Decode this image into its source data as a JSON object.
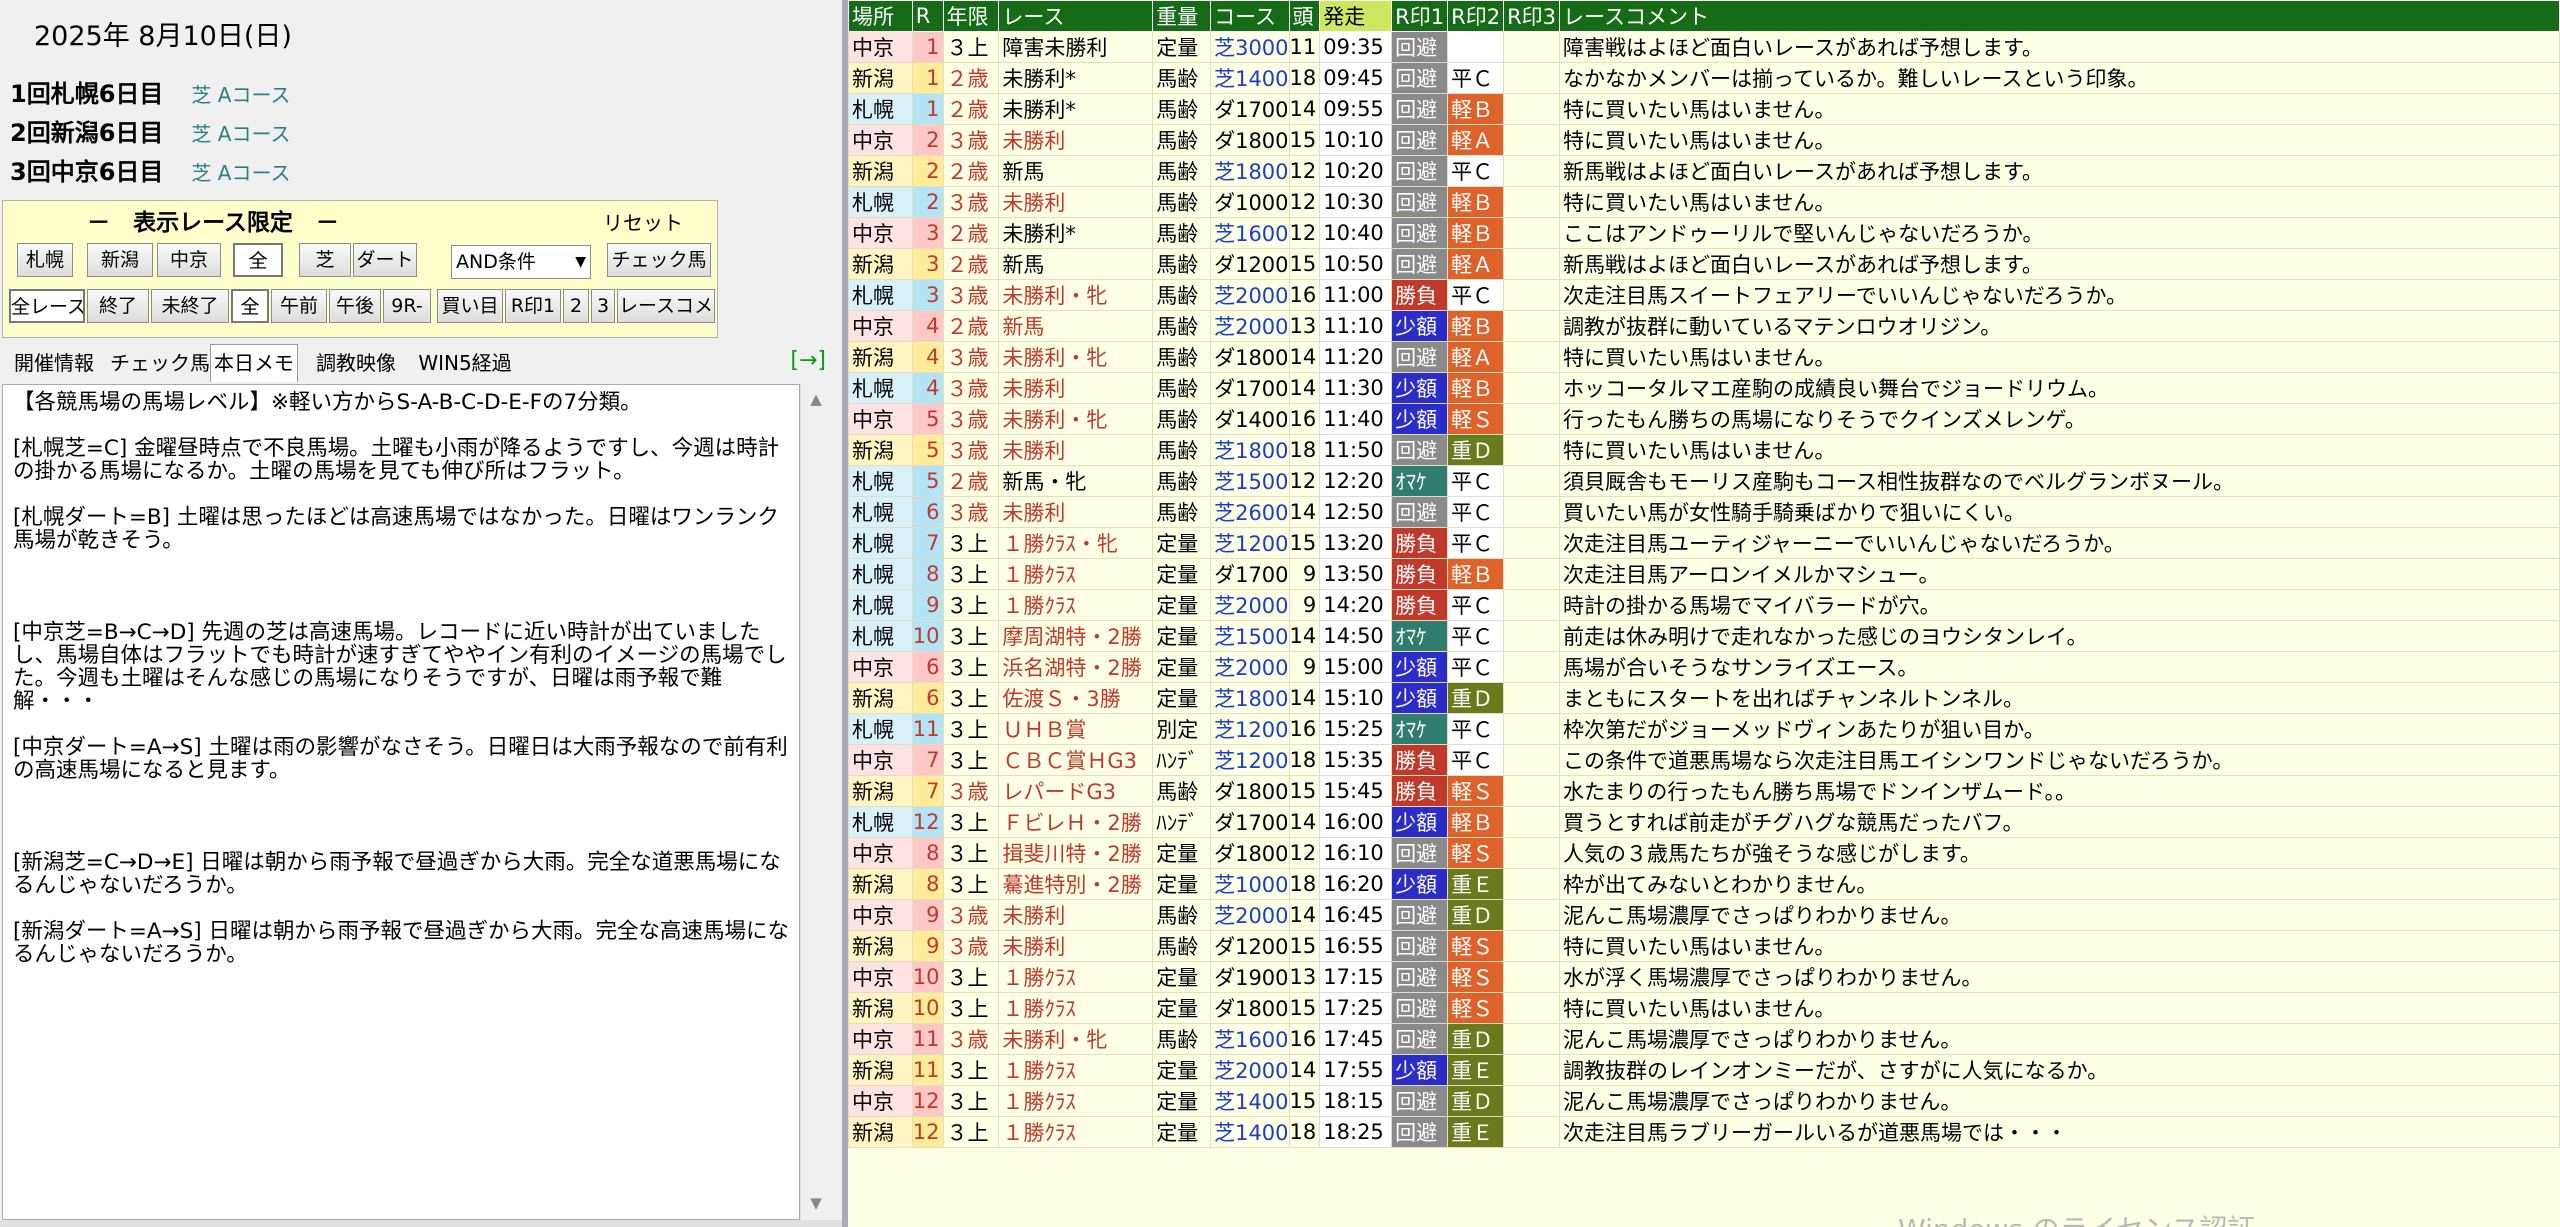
{
  "date": "2025年 8月10日(日)",
  "meetings": [
    {
      "name": "1回札幌6日目",
      "course": "芝 Aコース"
    },
    {
      "name": "2回新潟6日目",
      "course": "芝 Aコース"
    },
    {
      "name": "3回中京6日目",
      "course": "芝 Aコース"
    }
  ],
  "filter": {
    "title": "－　表示レース限定　－",
    "reset": "リセット",
    "track_buttons": [
      "札幌",
      "新潟",
      "中京"
    ],
    "surface_buttons": [
      "全",
      "芝",
      "ダート"
    ],
    "condition": "AND条件",
    "condition_arrow": "▼",
    "check_btn": "チェック馬",
    "row2": [
      "全レース",
      "終了",
      "未終了",
      "全",
      "午前",
      "午後",
      "9R-",
      "買い目",
      "R印1",
      "2",
      "3",
      "レースコメ"
    ]
  },
  "tabs": [
    "開催情報",
    "チェック馬",
    "本日メモ",
    "調教映像",
    "WIN5経過"
  ],
  "tab_arrow": "[→]",
  "memo": [
    "【各競馬場の馬場レベル】※軽い方からS-A-B-C-D-E-Fの7分類。",
    "",
    "[札幌芝=C] 金曜昼時点で不良馬場。土曜も小雨が降るようですし、今週は時計の掛かる馬場になるか。土曜の馬場を見ても伸び所はフラット。",
    "",
    "[札幌ダート=B] 土曜は思ったほどは高速馬場ではなかった。日曜はワンランク馬場が乾きそう。",
    "",
    "",
    "",
    "[中京芝=B→C→D] 先週の芝は高速馬場。レコードに近い時計が出ていましたし、馬場自体はフラットでも時計が速すぎてややイン有利のイメージの馬場でした。今週も土曜はそんな感じの馬場になりそうですが、日曜は雨予報で難解・・・",
    "",
    "[中京ダート=A→S] 土曜は雨の影響がなさそう。日曜日は大雨予報なので前有利の高速馬場になると見ます。",
    "",
    "",
    "",
    "[新潟芝=C→D→E] 日曜は朝から雨予報で昼過ぎから大雨。完全な道悪馬場になるんじゃないだろうか。",
    "",
    "[新潟ダート=A→S] 日曜は朝から雨予報で昼過ぎから大雨。完全な高速馬場になるんじゃないだろうか。"
  ],
  "scroll_up": "▲",
  "scroll_down": "▼",
  "columns": [
    "場所",
    "R",
    "年限",
    "レース",
    "重量",
    "コース",
    "頭",
    "発走",
    "R印1",
    "R印2",
    "R印3",
    "レースコメント"
  ],
  "colors": {
    "header": "#166b16",
    "avoid": "#8a8a8a",
    "win": "#c0392b",
    "fixed": "#2c2cc8",
    "safe": "#2e7d6e",
    "light": "#e0622b",
    "heavy": "#6c7a1e"
  },
  "rows": [
    {
      "place": "中京",
      "r": "1",
      "age": "３上",
      "race": "障害未勝利",
      "wt": "定量",
      "course": "芝3000",
      "heads": "11",
      "post": "09:35",
      "m1": "回避",
      "m2": "",
      "m3": "",
      "comment": "障害戦はよほど面白いレースがあれば予想します。"
    },
    {
      "place": "新潟",
      "r": "1",
      "age": "２歳",
      "race": "未勝利*",
      "wt": "馬齢",
      "course": "芝1400",
      "heads": "18",
      "post": "09:45",
      "m1": "回避",
      "m2": "平Ｃ",
      "m3": "",
      "comment": "なかなかメンバーは揃っているか。難しいレースという印象。"
    },
    {
      "place": "札幌",
      "r": "1",
      "age": "２歳",
      "race": "未勝利*",
      "wt": "馬齢",
      "course": "ダ1700",
      "heads": "14",
      "post": "09:55",
      "m1": "回避",
      "m2": "軽Ｂ",
      "m3": "",
      "comment": "特に買いたい馬はいません。"
    },
    {
      "place": "中京",
      "r": "2",
      "age": "３歳",
      "race": "未勝利",
      "wt": "馬齢",
      "course": "ダ1800",
      "heads": "15",
      "post": "10:10",
      "m1": "回避",
      "m2": "軽Ａ",
      "m3": "",
      "comment": "特に買いたい馬はいません。"
    },
    {
      "place": "新潟",
      "r": "2",
      "age": "２歳",
      "race": "新馬",
      "wt": "馬齢",
      "course": "芝1800",
      "heads": "12",
      "post": "10:20",
      "m1": "回避",
      "m2": "平Ｃ",
      "m3": "",
      "comment": "新馬戦はよほど面白いレースがあれば予想します。"
    },
    {
      "place": "札幌",
      "r": "2",
      "age": "３歳",
      "race": "未勝利",
      "wt": "馬齢",
      "course": "ダ1000",
      "heads": "12",
      "post": "10:30",
      "m1": "回避",
      "m2": "軽Ｂ",
      "m3": "",
      "comment": "特に買いたい馬はいません。"
    },
    {
      "place": "中京",
      "r": "3",
      "age": "２歳",
      "race": "未勝利*",
      "wt": "馬齢",
      "course": "芝1600",
      "heads": "12",
      "post": "10:40",
      "m1": "回避",
      "m2": "軽Ｂ",
      "m3": "",
      "comment": "ここはアンドゥーリルで堅いんじゃないだろうか。"
    },
    {
      "place": "新潟",
      "r": "3",
      "age": "２歳",
      "race": "新馬",
      "wt": "馬齢",
      "course": "ダ1200",
      "heads": "15",
      "post": "10:50",
      "m1": "回避",
      "m2": "軽Ａ",
      "m3": "",
      "comment": "新馬戦はよほど面白いレースがあれば予想します。"
    },
    {
      "place": "札幌",
      "r": "3",
      "age": "３歳",
      "race": "未勝利・牝",
      "wt": "馬齢",
      "course": "芝2000",
      "heads": "16",
      "post": "11:00",
      "m1": "勝負",
      "m2": "平Ｃ",
      "m3": "",
      "comment": "次走注目馬スイートフェアリーでいいんじゃないだろうか。"
    },
    {
      "place": "中京",
      "r": "4",
      "age": "２歳",
      "race": "新馬",
      "wt": "馬齢",
      "course": "芝2000",
      "heads": "13",
      "post": "11:10",
      "m1": "少額",
      "m2": "軽Ｂ",
      "m3": "",
      "comment": "調教が抜群に動いているマテンロウオリジン。"
    },
    {
      "place": "新潟",
      "r": "4",
      "age": "３歳",
      "race": "未勝利・牝",
      "wt": "馬齢",
      "course": "ダ1800",
      "heads": "14",
      "post": "11:20",
      "m1": "回避",
      "m2": "軽Ａ",
      "m3": "",
      "comment": "特に買いたい馬はいません。"
    },
    {
      "place": "札幌",
      "r": "4",
      "age": "３歳",
      "race": "未勝利",
      "wt": "馬齢",
      "course": "ダ1700",
      "heads": "14",
      "post": "11:30",
      "m1": "少額",
      "m2": "軽Ｂ",
      "m3": "",
      "comment": "ホッコータルマエ産駒の成績良い舞台でジョードリウム。"
    },
    {
      "place": "中京",
      "r": "5",
      "age": "３歳",
      "race": "未勝利・牝",
      "wt": "馬齢",
      "course": "ダ1400",
      "heads": "16",
      "post": "11:40",
      "m1": "少額",
      "m2": "軽Ｓ",
      "m3": "",
      "comment": "行ったもん勝ちの馬場になりそうでクインズメレンゲ。"
    },
    {
      "place": "新潟",
      "r": "5",
      "age": "３歳",
      "race": "未勝利",
      "wt": "馬齢",
      "course": "芝1800",
      "heads": "18",
      "post": "11:50",
      "m1": "回避",
      "m2": "重Ｄ",
      "m3": "",
      "comment": "特に買いたい馬はいません。"
    },
    {
      "place": "札幌",
      "r": "5",
      "age": "２歳",
      "race": "新馬・牝",
      "wt": "馬齢",
      "course": "芝1500",
      "heads": "12",
      "post": "12:20",
      "m1": "ｵﾏｹ",
      "m2": "平Ｃ",
      "m3": "",
      "comment": "須貝厩舎もモーリス産駒もコース相性抜群なのでベルグランボヌール。"
    },
    {
      "place": "札幌",
      "r": "6",
      "age": "３歳",
      "race": "未勝利",
      "wt": "馬齢",
      "course": "芝2600",
      "heads": "14",
      "post": "12:50",
      "m1": "回避",
      "m2": "平Ｃ",
      "m3": "",
      "comment": "買いたい馬が女性騎手騎乗ばかりで狙いにくい。"
    },
    {
      "place": "札幌",
      "r": "7",
      "age": "３上",
      "race": "１勝ｸﾗｽ・牝",
      "wt": "定量",
      "course": "芝1200",
      "heads": "15",
      "post": "13:20",
      "m1": "勝負",
      "m2": "平Ｃ",
      "m3": "",
      "comment": "次走注目馬ユーティジャーニーでいいんじゃないだろうか。"
    },
    {
      "place": "札幌",
      "r": "8",
      "age": "３上",
      "race": "１勝ｸﾗｽ",
      "wt": "定量",
      "course": "ダ1700",
      "heads": "9",
      "post": "13:50",
      "m1": "勝負",
      "m2": "軽Ｂ",
      "m3": "",
      "comment": "次走注目馬アーロンイメルかマシュー。"
    },
    {
      "place": "札幌",
      "r": "9",
      "age": "３上",
      "race": "１勝ｸﾗｽ",
      "wt": "定量",
      "course": "芝2000",
      "heads": "9",
      "post": "14:20",
      "m1": "勝負",
      "m2": "平Ｃ",
      "m3": "",
      "comment": "時計の掛かる馬場でマイバラードが穴。"
    },
    {
      "place": "札幌",
      "r": "10",
      "age": "３上",
      "race": "摩周湖特・2勝",
      "wt": "定量",
      "course": "芝1500",
      "heads": "14",
      "post": "14:50",
      "m1": "ｵﾏｹ",
      "m2": "平Ｃ",
      "m3": "",
      "comment": "前走は休み明けで走れなかった感じのヨウシタンレイ。"
    },
    {
      "place": "中京",
      "r": "6",
      "age": "３上",
      "race": "浜名湖特・2勝",
      "wt": "定量",
      "course": "芝2000",
      "heads": "9",
      "post": "15:00",
      "m1": "少額",
      "m2": "平Ｃ",
      "m3": "",
      "comment": "馬場が合いそうなサンライズエース。"
    },
    {
      "place": "新潟",
      "r": "6",
      "age": "３上",
      "race": "佐渡Ｓ・3勝",
      "wt": "定量",
      "course": "芝1800",
      "heads": "14",
      "post": "15:10",
      "m1": "少額",
      "m2": "重Ｄ",
      "m3": "",
      "comment": "まともにスタートを出ればチャンネルトンネル。"
    },
    {
      "place": "札幌",
      "r": "11",
      "age": "３上",
      "race": "ＵＨＢ賞",
      "wt": "別定",
      "course": "芝1200",
      "heads": "16",
      "post": "15:25",
      "m1": "ｵﾏｹ",
      "m2": "平Ｃ",
      "m3": "",
      "comment": "枠次第だがジョーメッドヴィンあたりが狙い目か。"
    },
    {
      "place": "中京",
      "r": "7",
      "age": "３上",
      "race": "ＣＢＣ賞ＨG3",
      "wt": "ﾊﾝﾃﾞ",
      "course": "芝1200",
      "heads": "18",
      "post": "15:35",
      "m1": "勝負",
      "m2": "平Ｃ",
      "m3": "",
      "comment": "この条件で道悪馬場なら次走注目馬エイシンワンドじゃないだろうか。"
    },
    {
      "place": "新潟",
      "r": "7",
      "age": "３歳",
      "race": "レパードG3",
      "wt": "馬齢",
      "course": "ダ1800",
      "heads": "15",
      "post": "15:45",
      "m1": "勝負",
      "m2": "軽Ｓ",
      "m3": "",
      "comment": "水たまりの行ったもん勝ち馬場でドンインザムード。。"
    },
    {
      "place": "札幌",
      "r": "12",
      "age": "３上",
      "race": "ＦビレＨ・2勝",
      "wt": "ﾊﾝﾃﾞ",
      "course": "ダ1700",
      "heads": "14",
      "post": "16:00",
      "m1": "少額",
      "m2": "軽Ｂ",
      "m3": "",
      "comment": "買うとすれば前走がチグハグな競馬だったバフ。"
    },
    {
      "place": "中京",
      "r": "8",
      "age": "３上",
      "race": "揖斐川特・2勝",
      "wt": "定量",
      "course": "ダ1800",
      "heads": "12",
      "post": "16:10",
      "m1": "回避",
      "m2": "軽Ｓ",
      "m3": "",
      "comment": "人気の３歳馬たちが強そうな感じがします。"
    },
    {
      "place": "新潟",
      "r": "8",
      "age": "３上",
      "race": "驀進特別・2勝",
      "wt": "定量",
      "course": "芝1000",
      "heads": "18",
      "post": "16:20",
      "m1": "少額",
      "m2": "重Ｅ",
      "m3": "",
      "comment": "枠が出てみないとわかりません。"
    },
    {
      "place": "中京",
      "r": "9",
      "age": "３歳",
      "race": "未勝利",
      "wt": "馬齢",
      "course": "芝2000",
      "heads": "14",
      "post": "16:45",
      "m1": "回避",
      "m2": "重Ｄ",
      "m3": "",
      "comment": "泥んこ馬場濃厚でさっぱりわかりません。"
    },
    {
      "place": "新潟",
      "r": "9",
      "age": "３歳",
      "race": "未勝利",
      "wt": "馬齢",
      "course": "ダ1200",
      "heads": "15",
      "post": "16:55",
      "m1": "回避",
      "m2": "軽Ｓ",
      "m3": "",
      "comment": "特に買いたい馬はいません。"
    },
    {
      "place": "中京",
      "r": "10",
      "age": "３上",
      "race": "１勝ｸﾗｽ",
      "wt": "定量",
      "course": "ダ1900",
      "heads": "13",
      "post": "17:15",
      "m1": "回避",
      "m2": "軽Ｓ",
      "m3": "",
      "comment": "水が浮く馬場濃厚でさっぱりわかりません。"
    },
    {
      "place": "新潟",
      "r": "10",
      "age": "３上",
      "race": "１勝ｸﾗｽ",
      "wt": "定量",
      "course": "ダ1800",
      "heads": "15",
      "post": "17:25",
      "m1": "回避",
      "m2": "軽Ｓ",
      "m3": "",
      "comment": "特に買いたい馬はいません。"
    },
    {
      "place": "中京",
      "r": "11",
      "age": "３歳",
      "race": "未勝利・牝",
      "wt": "馬齢",
      "course": "芝1600",
      "heads": "16",
      "post": "17:45",
      "m1": "回避",
      "m2": "重Ｄ",
      "m3": "",
      "comment": "泥んこ馬場濃厚でさっぱりわかりません。"
    },
    {
      "place": "新潟",
      "r": "11",
      "age": "３上",
      "race": "１勝ｸﾗｽ",
      "wt": "定量",
      "course": "芝2000",
      "heads": "14",
      "post": "17:55",
      "m1": "少額",
      "m2": "重Ｅ",
      "m3": "",
      "comment": "調教抜群のレインオンミーだが、さすがに人気になるか。"
    },
    {
      "place": "中京",
      "r": "12",
      "age": "３上",
      "race": "１勝ｸﾗｽ",
      "wt": "定量",
      "course": "芝1400",
      "heads": "15",
      "post": "18:15",
      "m1": "回避",
      "m2": "重Ｄ",
      "m3": "",
      "comment": "泥んこ馬場濃厚でさっぱりわかりません。"
    },
    {
      "place": "新潟",
      "r": "12",
      "age": "３上",
      "race": "１勝ｸﾗｽ",
      "wt": "定量",
      "course": "芝1400",
      "heads": "18",
      "post": "18:25",
      "m1": "回避",
      "m2": "重Ｅ",
      "m3": "",
      "comment": "次走注目馬ラブリーガールいるが道悪馬場では・・・"
    }
  ],
  "watermark": "Windows のライセンス認証"
}
